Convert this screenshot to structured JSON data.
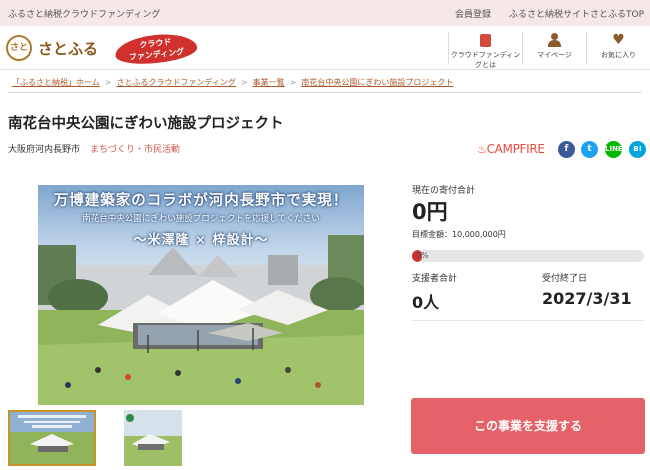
{
  "topbar": {
    "tagline": "ふるさと納税クラウドファンディング",
    "links": [
      "会員登録",
      "ふるさと納税サイトさとふるTOP"
    ]
  },
  "header": {
    "logo_mark": "さと",
    "logo_text": "さとふる",
    "cf_badge_line1": "クラウド",
    "cf_badge_line2": "ファンディング",
    "nav": [
      {
        "label": "クラウドファンディングとは",
        "icon": "book-icon"
      },
      {
        "label": "マイページ",
        "icon": "person-icon"
      },
      {
        "label": "お気に入り",
        "icon": "heart-icon"
      }
    ]
  },
  "breadcrumb": [
    "「ふるさと納税」ホーム",
    "さとふるクラウドファンディング",
    "事業一覧",
    "南花台中央公園にぎわい施設プロジェクト"
  ],
  "project": {
    "title": "南花台中央公園にぎわい施設プロジェクト",
    "location": "大阪府河内長野市",
    "category": "まちづくり・市民活動",
    "platform": "CAMPFIRE",
    "hero_line1": "万博建築家のコラボが河内長野市で実現！",
    "hero_line2": "南花台中央公園にぎわい施設プロジェクトを応援してください",
    "hero_line3": "〜米澤隆 × 梓設計〜"
  },
  "social": {
    "facebook": "f",
    "twitter": "t",
    "line": "LINE",
    "hatena": "B!"
  },
  "stats": {
    "total_label": "現在の寄付合計",
    "total_value": "0円",
    "goal_text": "目標金額：10,000,000円",
    "progress_text": "0%",
    "progress_fraction": 0,
    "supporters_label": "支援者合計",
    "supporters_value": "0人",
    "deadline_label": "受付終了日",
    "deadline_value": "2027/3/31"
  },
  "cta": {
    "label": "この事業を支援する"
  },
  "colors": {
    "accent": "#d0312d",
    "button": "#e56268",
    "topbar": "#f6e8e8"
  }
}
